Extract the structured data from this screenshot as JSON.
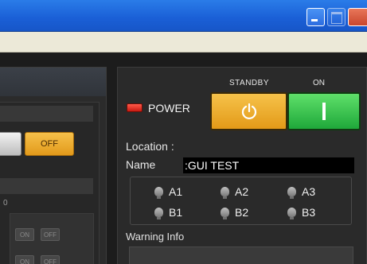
{
  "window": {
    "controls": [
      "minimize-icon",
      "maximize-icon",
      "close-icon"
    ]
  },
  "left_panel": {
    "off_label": "OFF",
    "partial_value": "0",
    "mini_buttons": [
      {
        "on": "ON",
        "off": "OFF"
      },
      {
        "on": "ON",
        "off": "OFF"
      }
    ]
  },
  "power": {
    "label": "POWER",
    "led_color": "#e8251a",
    "standby_label": "STANDBY",
    "on_label": "ON",
    "standby_icon": "power-icon",
    "on_icon": "power-on-bar-icon",
    "standby_color": "#f0b030",
    "on_color": "#3cc84e"
  },
  "info": {
    "location_label": "Location :",
    "name_label": "Name",
    "name_colon": ":",
    "name_value": "GUI TEST"
  },
  "sensors": [
    {
      "label": "A1"
    },
    {
      "label": "A2"
    },
    {
      "label": "A3"
    },
    {
      "label": "B1"
    },
    {
      "label": "B2"
    },
    {
      "label": "B3"
    }
  ],
  "warning": {
    "label": "Warning Info"
  }
}
